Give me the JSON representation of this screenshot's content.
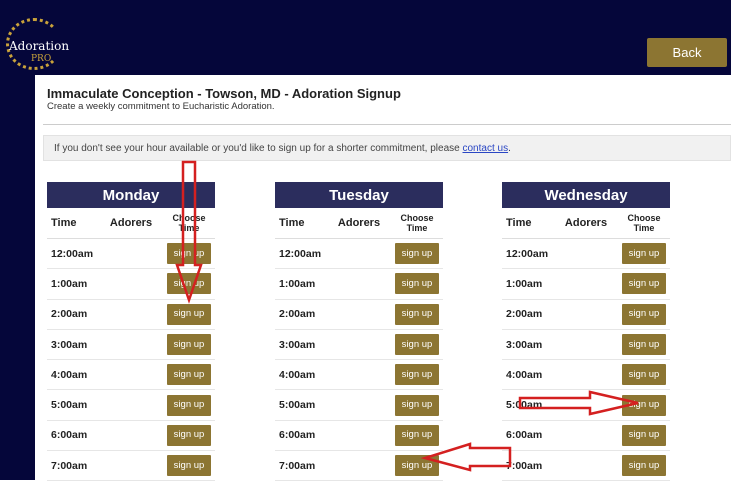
{
  "header": {
    "logo_text": "Adoration",
    "logo_sub": "PRO",
    "back_label": "Back"
  },
  "page": {
    "title": "Immaculate Conception - Towson, MD - Adoration Signup",
    "subtitle": "Create a weekly commitment to Eucharistic Adoration.",
    "notice_text": "If you don't see your hour available or you'd like to sign up for a shorter commitment, please ",
    "notice_link": "contact us",
    "notice_end": "."
  },
  "columns": {
    "time": "Time",
    "adorers": "Adorers",
    "choose": "Choose Time"
  },
  "days": [
    {
      "name": "Monday"
    },
    {
      "name": "Tuesday"
    },
    {
      "name": "Wednesday"
    }
  ],
  "times": [
    "12:00am",
    "1:00am",
    "2:00am",
    "3:00am",
    "4:00am",
    "5:00am",
    "6:00am",
    "7:00am"
  ],
  "signup_label": "sign up",
  "colors": {
    "nav": "#05063a",
    "day_header": "#2b2d5d",
    "button": "#8c7532",
    "arrow": "#d42020"
  }
}
